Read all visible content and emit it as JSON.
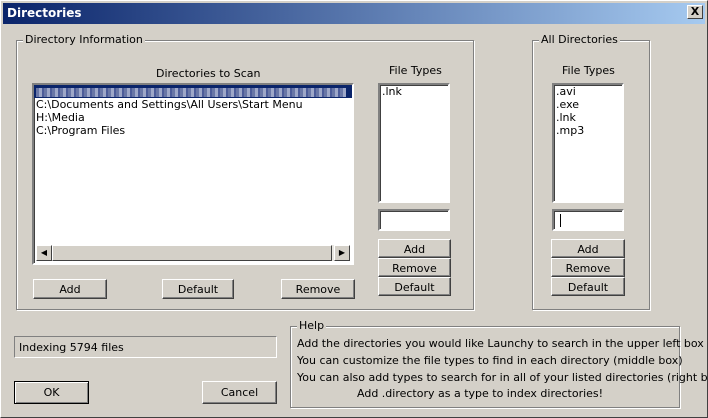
{
  "window": {
    "title": "Directories",
    "close_glyph": "X"
  },
  "directory_info": {
    "legend": "Directory Information",
    "dirs_header": "Directories to Scan",
    "directories": [
      "C:\\Documents and Settings\\All Users\\Start Menu",
      "H:\\Media",
      "C:\\Program Files"
    ],
    "buttons": {
      "add": "Add",
      "default": "Default",
      "remove": "Remove"
    },
    "file_types_header": "File Types",
    "file_types": [
      ".lnk"
    ],
    "type_buttons": {
      "add": "Add",
      "remove": "Remove",
      "default": "Default"
    }
  },
  "all_directories": {
    "legend": "All Directories",
    "file_types_header": "File Types",
    "file_types": [
      ".avi",
      ".exe",
      ".lnk",
      ".mp3"
    ],
    "type_buttons": {
      "add": "Add",
      "remove": "Remove",
      "default": "Default"
    }
  },
  "status": {
    "text": "Indexing 5794 files"
  },
  "help": {
    "legend": "Help",
    "lines": [
      "Add the directories you would like Launchy to search in the upper left box",
      "You can customize the file types to find in each directory (middle box)",
      "You can also add types to search for in all of your listed directories (right box)",
      "Add .directory as a type to index directories!"
    ]
  },
  "dialog_buttons": {
    "ok": "OK",
    "cancel": "Cancel"
  },
  "colors": {
    "titlebar_start": "#0a246a",
    "titlebar_end": "#a6caf0",
    "selection": "#0a246a",
    "face": "#d4d0c8"
  }
}
